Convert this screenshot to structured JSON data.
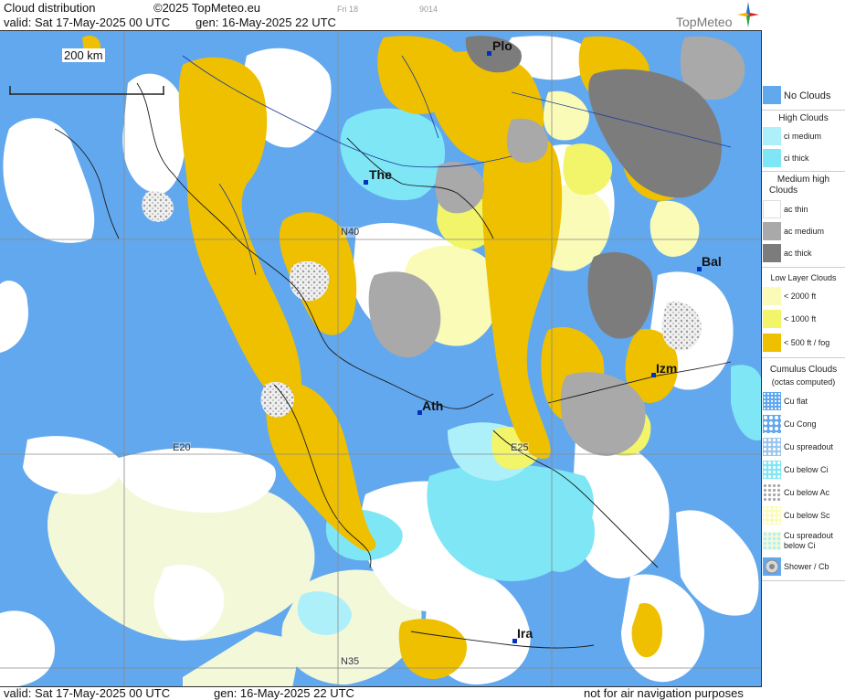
{
  "header": {
    "title": "Cloud distribution",
    "copyright": "©2025 TopMeteo.eu",
    "valid": "valid:  Sat  17-May-2025  00 UTC",
    "gen": "gen: 16-May-2025 22 UTC",
    "tab_day": "Fri 18",
    "tab_code": "9014",
    "logo": "TopMeteo"
  },
  "map": {
    "scale": "200 km",
    "cities": [
      {
        "name": "Plo"
      },
      {
        "name": "The"
      },
      {
        "name": "Bal"
      },
      {
        "name": "Izm"
      },
      {
        "name": "Ath"
      },
      {
        "name": "Ira"
      }
    ],
    "grid": {
      "lat_n40": "N40",
      "lat_n35": "N35",
      "lon_e20": "E20",
      "lon_e25": "E25"
    }
  },
  "footer": {
    "valid": "valid:  Sat  17-May-2025  00 UTC",
    "gen": "gen: 16-May-2025 22 UTC",
    "disclaimer": "not for air navigation purposes"
  },
  "legend": {
    "no_clouds": "No Clouds",
    "high_head": "High Clouds",
    "ci_medium": "ci medium",
    "ci_thick": "ci thick",
    "medium_head_1": "Medium high",
    "medium_head_2": "Clouds",
    "ac_thin": "ac thin",
    "ac_medium": "ac medium",
    "ac_thick": "ac thick",
    "low_head": "Low Layer Clouds",
    "low_2000": "< 2000 ft",
    "low_1000": "< 1000 ft",
    "low_500": "< 500 ft / fog",
    "cu_head_1": "Cumulus Clouds",
    "cu_head_2": "(octas computed)",
    "cu_flat": "Cu flat",
    "cu_cong": "Cu Cong",
    "cu_spread": "Cu spreadout",
    "cu_below_ci": "Cu below Ci",
    "cu_below_ac": "Cu below Ac",
    "cu_below_sc": "Cu below Sc",
    "cu_spread_ci_1": "Cu spreadout",
    "cu_spread_ci_2": "below Ci",
    "shower": "Shower / Cb"
  },
  "colors": {
    "sea": "#62a8ee",
    "no_clouds": "#62a8ee",
    "ci_medium": "#aef0fa",
    "ci_thick": "#7ee6f5",
    "ac_thin": "#ffffff",
    "ac_medium": "#a9a9a9",
    "ac_thick": "#7c7c7c",
    "low_2000": "#fbfbb8",
    "low_1000": "#f2f56a",
    "low_500": "#efc000",
    "cu_light": "#f3f8d9"
  }
}
